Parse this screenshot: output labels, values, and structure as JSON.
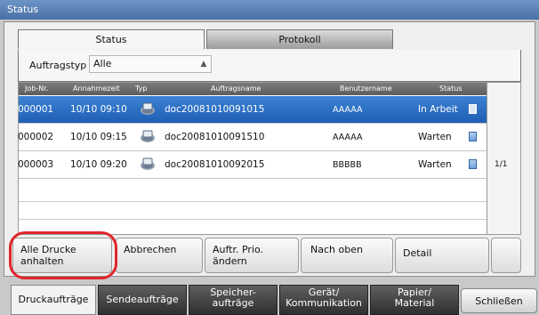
{
  "window": {
    "title": "Status"
  },
  "top_tabs": [
    {
      "label": "Status"
    },
    {
      "label": "Protokoll"
    }
  ],
  "filter": {
    "label": "Auftragstyp",
    "value": "Alle"
  },
  "table": {
    "columns": [
      "Job-Nr.",
      "Annahmezeit",
      "Typ",
      "Auftragsname",
      "Benutzername",
      "Status"
    ],
    "rows": [
      {
        "job": "000001",
        "time": "10/10 09:10",
        "type_icon": "printer-icon",
        "name": "doc20081010091015",
        "user": "AAAAA",
        "status": "In Arbeit",
        "selected": true
      },
      {
        "job": "000002",
        "time": "10/10 09:15",
        "type_icon": "printer-icon",
        "name": "doc20081010091510",
        "user": "AAAAA",
        "status": "Warten",
        "selected": false
      },
      {
        "job": "000003",
        "time": "10/10 09:20",
        "type_icon": "printer-icon",
        "name": "doc20081010092015",
        "user": "BBBBB",
        "status": "Warten",
        "selected": false
      }
    ]
  },
  "pager": {
    "text": "1/1"
  },
  "actions": {
    "pause_line1": "Alle Drucke",
    "pause_line2": "anhalten",
    "cancel": "Abbrechen",
    "prio_line1": "Auftr. Prio.",
    "prio_line2": "ändern",
    "to_top": "Nach oben",
    "detail": "Detail"
  },
  "bottom_tabs": {
    "druck": "Druckaufträge",
    "send": "Sendeaufträge",
    "speicher_line1": "Speicher-",
    "speicher_line2": "aufträge",
    "geraet_line1": "Gerät/",
    "geraet_line2": "Kommunikation",
    "papier_line1": "Papier/",
    "papier_line2": "Material",
    "close": "Schließen"
  },
  "colors": {
    "selection": "#1f5fb4",
    "highlight": "#e0262b",
    "titlebar": "#4a6fa5"
  }
}
